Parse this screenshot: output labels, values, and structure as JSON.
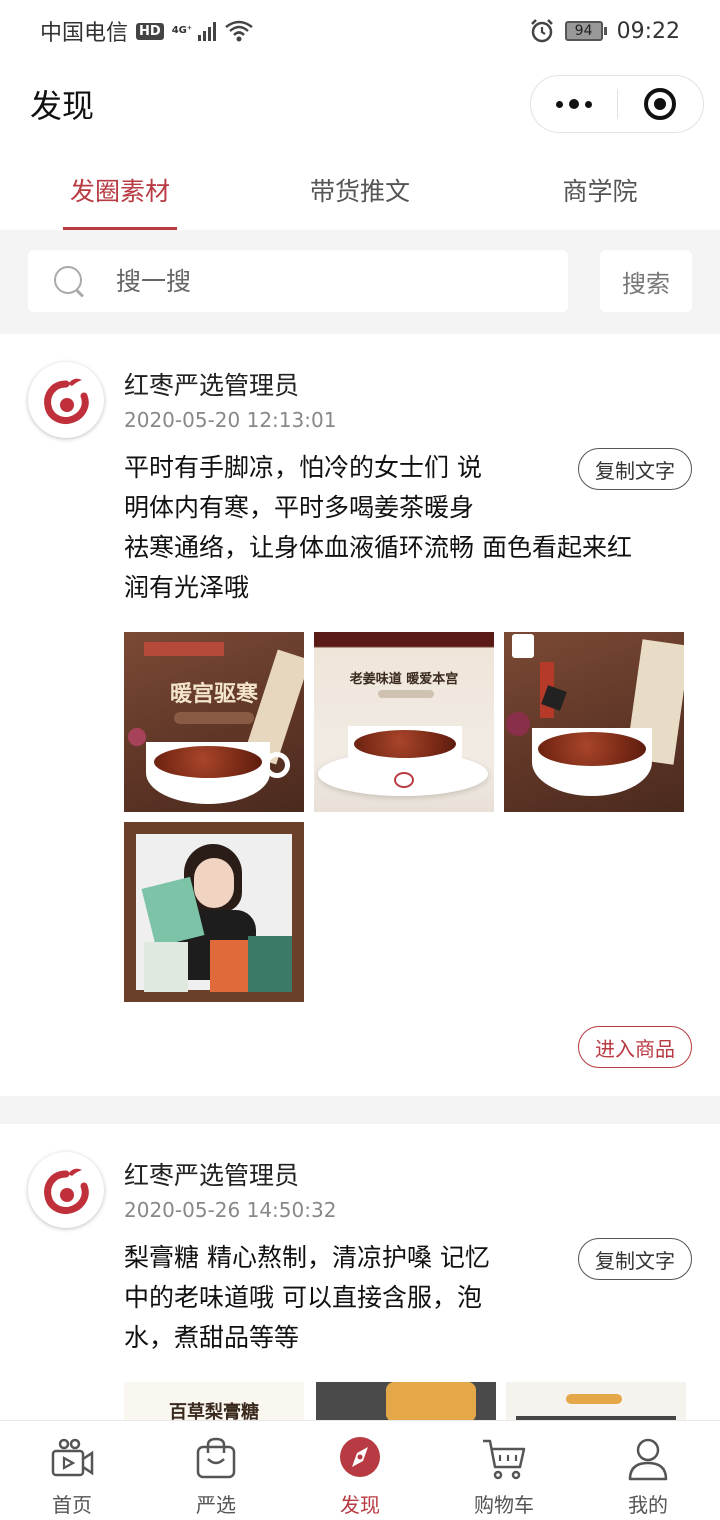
{
  "status_bar": {
    "carrier": "中国电信",
    "hd": "HD",
    "network": "4G⁺",
    "battery": "94",
    "time": "09:22"
  },
  "header": {
    "title": "发现"
  },
  "tabs": [
    {
      "label": "发圈素材",
      "active": true
    },
    {
      "label": "带货推文",
      "active": false
    },
    {
      "label": "商学院",
      "active": false
    }
  ],
  "search": {
    "placeholder": "搜一搜",
    "button_label": "搜索"
  },
  "posts": [
    {
      "author": "红枣严选管理员",
      "time": "2020-05-20 12:13:01",
      "lines": [
        "平时有手脚凉，怕冷的女士们 说",
        "明体内有寒，平时多喝姜茶暖身",
        "祛寒通络，让身体血液循环流畅 面色看起来红",
        "润有光泽哦"
      ],
      "copy_label": "复制文字",
      "enter_label": "进入商品",
      "images": [
        {
          "caption": "暖宫驱寒"
        },
        {
          "caption": "老姜味道 暖爱本宫"
        },
        {
          "caption": ""
        },
        {
          "caption": ""
        }
      ]
    },
    {
      "author": "红枣严选管理员",
      "time": "2020-05-26 14:50:32",
      "lines": [
        "梨膏糖 精心熬制，清凉护嗓 记忆",
        "中的老味道哦 可以直接含服，泡",
        "水，煮甜品等等"
      ],
      "copy_label": "复制文字",
      "images": [
        {
          "caption": "百草梨膏糖"
        },
        {
          "caption": ""
        },
        {
          "caption": ""
        }
      ]
    }
  ],
  "bottom_nav": [
    {
      "label": "首页",
      "icon": "video-camera-icon",
      "active": false
    },
    {
      "label": "严选",
      "icon": "shopping-bag-icon",
      "active": false
    },
    {
      "label": "发现",
      "icon": "compass-icon",
      "active": true
    },
    {
      "label": "购物车",
      "icon": "cart-icon",
      "active": false
    },
    {
      "label": "我的",
      "icon": "user-icon",
      "active": false
    }
  ],
  "colors": {
    "accent": "#b83a42",
    "background_gray": "#f4f4f4"
  }
}
